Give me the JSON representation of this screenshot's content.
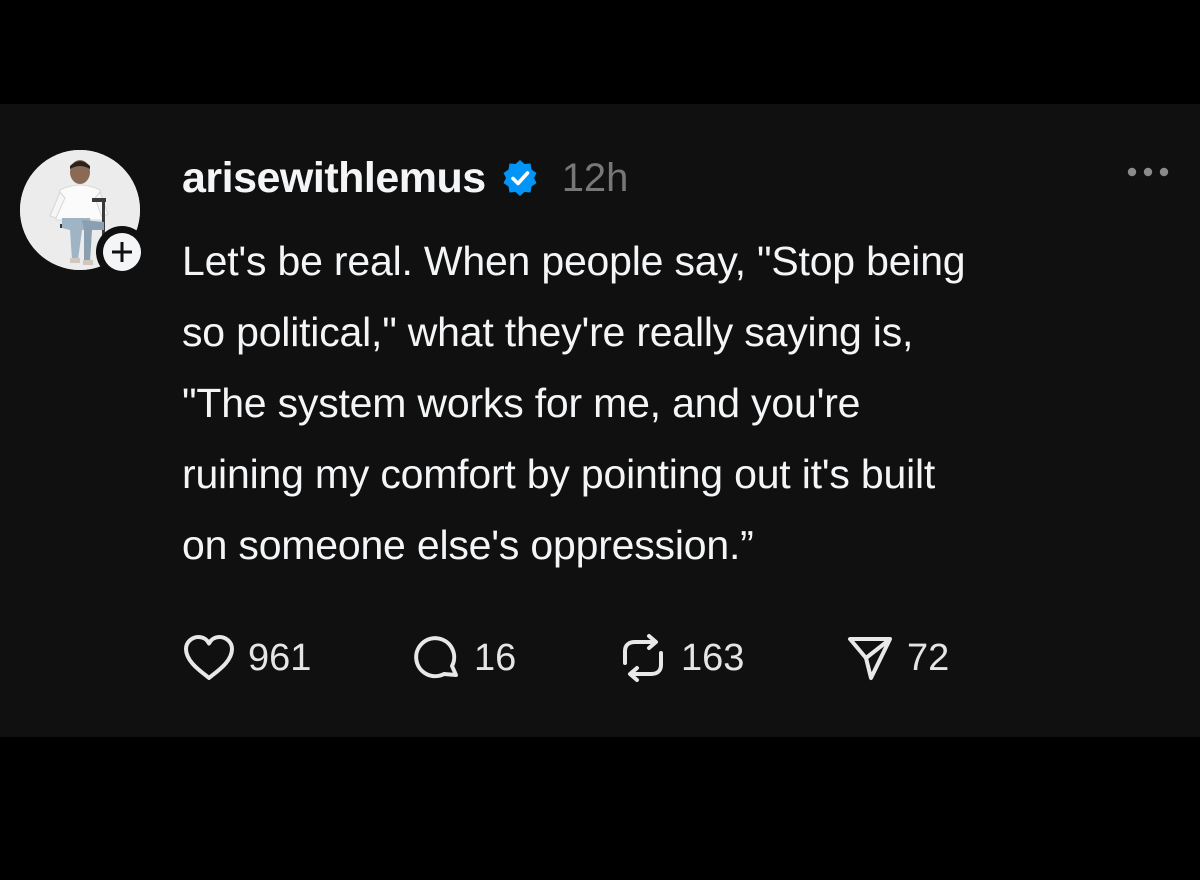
{
  "post": {
    "author": {
      "username": "arisewithlemus",
      "verified": true,
      "avatar_icon": "profile-photo",
      "follow_icon": "plus-icon"
    },
    "timestamp": "12h",
    "more_icon": "more-dots-icon",
    "text_lines": [
      "Let's be real. When people say, \"Stop being",
      "so political,\" what they're really saying is,",
      "\"The system works for me, and you're",
      "ruining my comfort by pointing out it's built",
      "on someone else's oppression.”"
    ],
    "actions": {
      "likes": "961",
      "replies": "16",
      "reposts": "163",
      "shares": "72"
    }
  },
  "colors": {
    "background": "#000000",
    "card": "#101010",
    "text": "#f3f5f7",
    "muted": "#777777",
    "verified_blue": "#0095f6"
  }
}
